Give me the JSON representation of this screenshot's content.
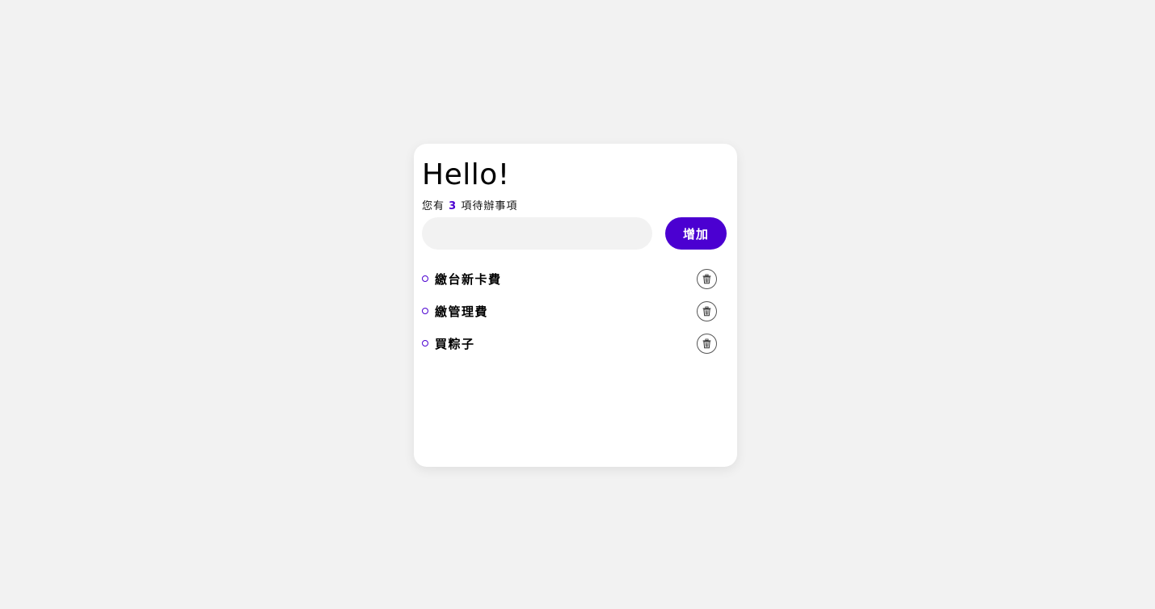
{
  "header": {
    "title": "Hello!",
    "summary_prefix": "您有",
    "count": "3",
    "summary_suffix": "項待辦事項"
  },
  "form": {
    "input_value": "",
    "input_placeholder": "",
    "add_label": "增加"
  },
  "todos": [
    {
      "text": "繳台新卡費",
      "icon": "trash-icon"
    },
    {
      "text": "繳管理費",
      "icon": "trash-icon"
    },
    {
      "text": "買粽子",
      "icon": "trash-icon"
    }
  ],
  "colors": {
    "accent": "#4b00d1",
    "background": "#f2f2f2",
    "card": "#ffffff"
  }
}
